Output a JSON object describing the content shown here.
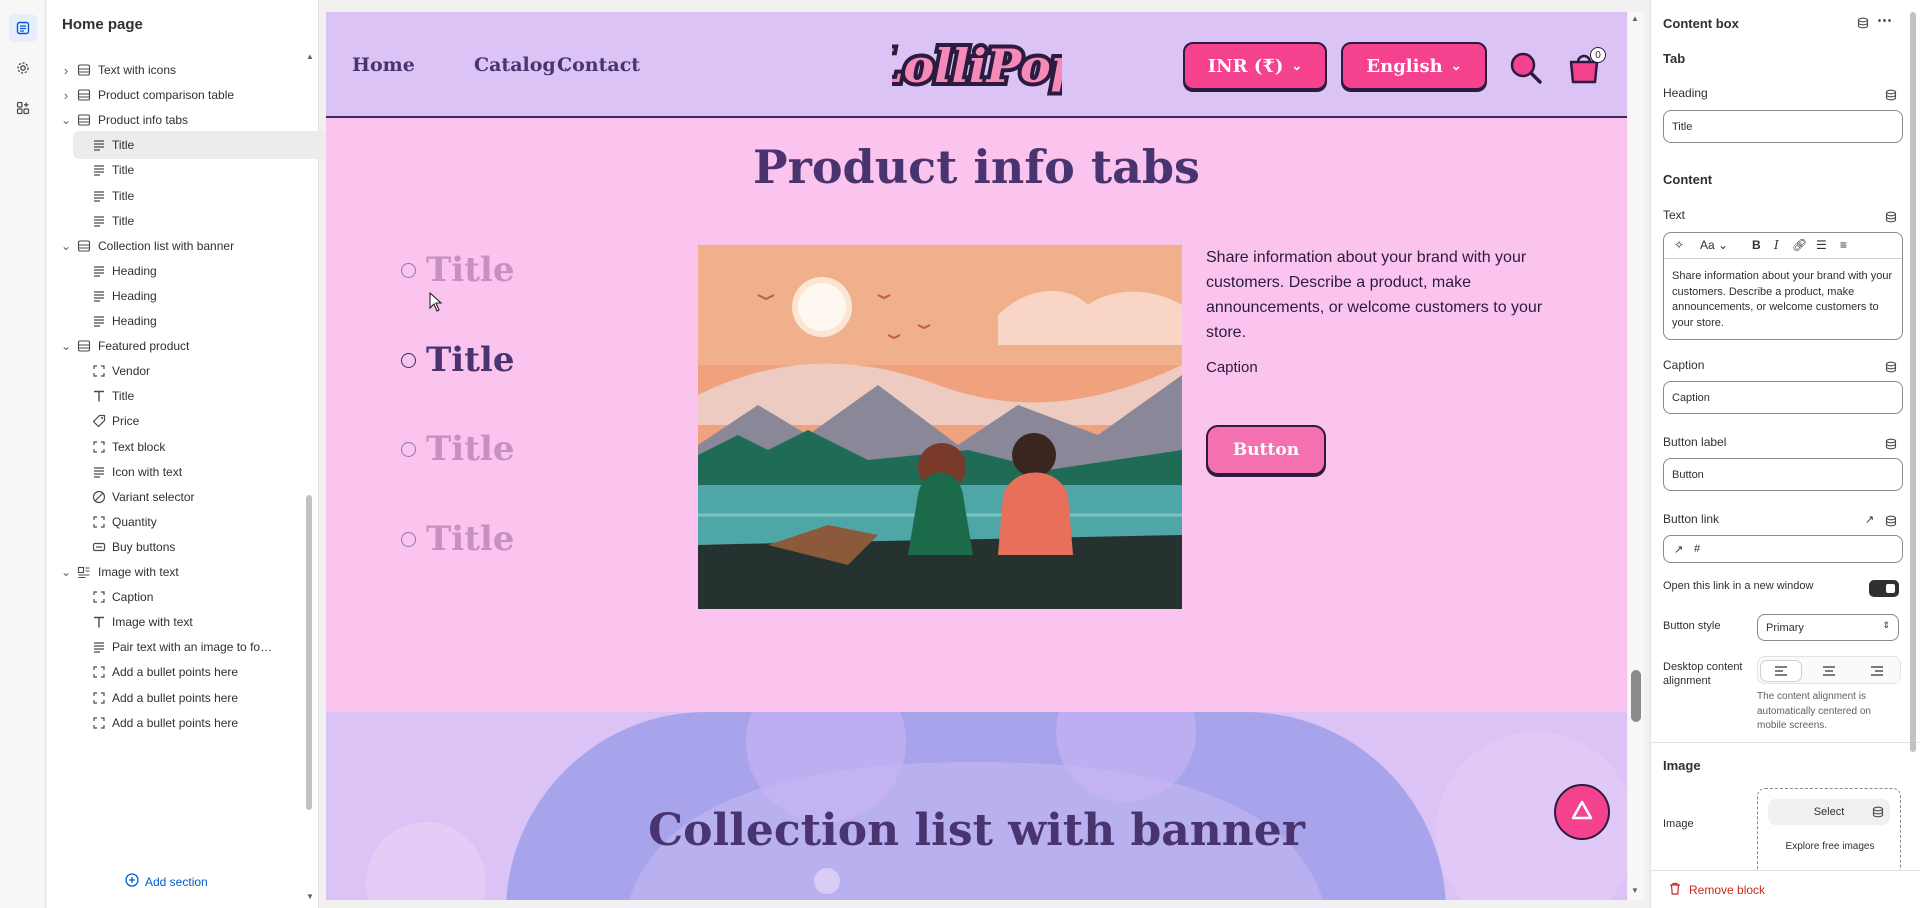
{
  "sidebar": {
    "title": "Home page",
    "add_section": "Add section",
    "rows": [
      {
        "label": "Text with icons",
        "level": 0,
        "chevron": "right",
        "icon": "section-icon"
      },
      {
        "label": "Product comparison table",
        "level": 0,
        "chevron": "right",
        "icon": "section-icon"
      },
      {
        "label": "Product info tabs",
        "level": 0,
        "chevron": "down",
        "icon": "section-icon"
      },
      {
        "label": "Title",
        "level": 1,
        "icon": "text-block-icon",
        "selected": true
      },
      {
        "label": "Title",
        "level": 1,
        "icon": "text-block-icon"
      },
      {
        "label": "Title",
        "level": 1,
        "icon": "text-block-icon"
      },
      {
        "label": "Title",
        "level": 1,
        "icon": "text-block-icon"
      },
      {
        "label": "Collection list with banner",
        "level": 0,
        "chevron": "down",
        "icon": "section-icon"
      },
      {
        "label": "Heading",
        "level": 1,
        "icon": "text-block-icon"
      },
      {
        "label": "Heading",
        "level": 1,
        "icon": "text-block-icon"
      },
      {
        "label": "Heading",
        "level": 1,
        "icon": "text-block-icon"
      },
      {
        "label": "Featured product",
        "level": 0,
        "chevron": "down",
        "icon": "section-icon"
      },
      {
        "label": "Vendor",
        "level": 1,
        "icon": "frame-icon"
      },
      {
        "label": "Title",
        "level": 1,
        "icon": "type-icon"
      },
      {
        "label": "Price",
        "level": 1,
        "icon": "price-tag-icon"
      },
      {
        "label": "Text block",
        "level": 1,
        "icon": "frame-icon"
      },
      {
        "label": "Icon with text",
        "level": 1,
        "icon": "text-block-icon"
      },
      {
        "label": "Variant selector",
        "level": 1,
        "icon": "variant-icon"
      },
      {
        "label": "Quantity",
        "level": 1,
        "icon": "frame-icon"
      },
      {
        "label": "Buy buttons",
        "level": 1,
        "icon": "buy-button-icon"
      },
      {
        "label": "Image with text",
        "level": 0,
        "chevron": "down",
        "icon": "image-text-icon"
      },
      {
        "label": "Caption",
        "level": 1,
        "icon": "frame-icon"
      },
      {
        "label": "Image with text",
        "level": 1,
        "icon": "type-icon"
      },
      {
        "label": "Pair text with an image to focus ...",
        "level": 1,
        "icon": "text-block-icon"
      },
      {
        "label": "Add a bullet points here",
        "level": 1,
        "icon": "frame-icon"
      },
      {
        "label": "Add a bullet points here",
        "level": 1,
        "icon": "frame-icon"
      },
      {
        "label": "Add a bullet points here",
        "level": 1,
        "icon": "frame-icon"
      }
    ]
  },
  "preview": {
    "header": {
      "nav": [
        "Home",
        "Catalog",
        "Contact"
      ],
      "logo_text": "LolliPop",
      "currency": "INR (₹)",
      "language": "English",
      "cart_count": "0"
    },
    "section_heading": "Product info tabs",
    "tabs": [
      {
        "label": "Title",
        "active": false
      },
      {
        "label": "Title",
        "active": true
      },
      {
        "label": "Title",
        "active": false
      },
      {
        "label": "Title",
        "active": false
      }
    ],
    "content_text": "Share information about your brand with your customers. Describe a product, make announcements, or welcome customers to your store.",
    "caption": "Caption",
    "button": "Button",
    "banner_heading": "Collection list with banner"
  },
  "inspector": {
    "title": "Content box",
    "tab_section": "Tab",
    "heading_label": "Heading",
    "heading_value": "Title",
    "content_section": "Content",
    "text_label": "Text",
    "rte_font_label": "Aa",
    "text_value": "Share information about your brand with your customers. Describe a product, make announcements, or welcome customers to your store.",
    "caption_label": "Caption",
    "caption_value": "Caption",
    "button_label_label": "Button label",
    "button_label_value": "Button",
    "button_link_label": "Button link",
    "button_link_value": "#",
    "new_window_label": "Open this link in a new window",
    "new_window_on": true,
    "button_style_label": "Button style",
    "button_style_value": "Primary",
    "alignment_label": "Desktop content alignment",
    "alignment_value": "left",
    "alignment_help": "The content alignment is automatically centered on mobile screens.",
    "image_section": "Image",
    "image_label": "Image",
    "select_button": "Select",
    "explore_link": "Explore free images",
    "remove_block": "Remove block"
  },
  "colors": {
    "header_bg": "#dcc3f5",
    "section_bg": "#fbc4ef",
    "accent_pink": "#f4428f",
    "heading_purple": "#4a3470",
    "link_blue": "#005bd3",
    "danger_red": "#c42a1d"
  }
}
